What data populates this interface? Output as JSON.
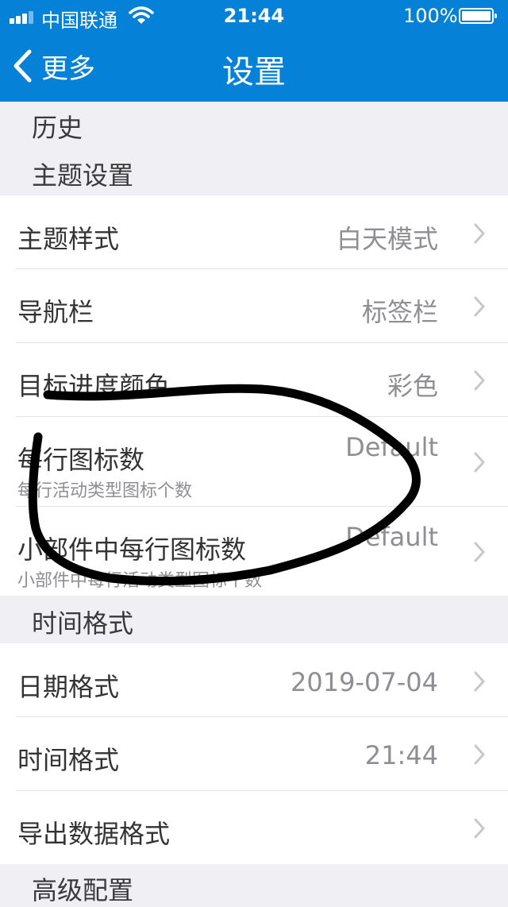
{
  "status_bar": {
    "carrier": "中国联通",
    "time": "21:44",
    "battery": "100%"
  },
  "nav": {
    "back_label": "更多",
    "title": "设置"
  },
  "top_items": [
    "历史"
  ],
  "sections": [
    {
      "title": "主题设置",
      "rows": [
        {
          "title": "主题样式",
          "value": "白天模式"
        },
        {
          "title": "导航栏",
          "value": "标签栏"
        },
        {
          "title": "目标进度颜色",
          "value": "彩色"
        },
        {
          "title": "每行图标数",
          "subtitle": "每行活动类型图标个数",
          "value": "Default"
        },
        {
          "title": "小部件中每行图标数",
          "subtitle": "小部件中每行活动类型图标个数",
          "value": "Default"
        }
      ]
    },
    {
      "title": "时间格式",
      "rows": [
        {
          "title": "日期格式",
          "value": "2019-07-04"
        },
        {
          "title": "时间格式",
          "value": "21:44"
        },
        {
          "title": "导出数据格式",
          "value": ""
        }
      ]
    },
    {
      "title": "高级配置",
      "rows": []
    }
  ],
  "colors": {
    "nav_bar": "#0582d8",
    "background": "#efeff4",
    "cell": "#ffffff",
    "annotation_stroke": "#000000"
  },
  "icons": [
    "signal-bars-icon",
    "wifi-icon",
    "battery-icon",
    "back-chevron-icon",
    "chevron-right-icon"
  ],
  "annotation": "hand-drawn black loop over the icons-per-row rows"
}
